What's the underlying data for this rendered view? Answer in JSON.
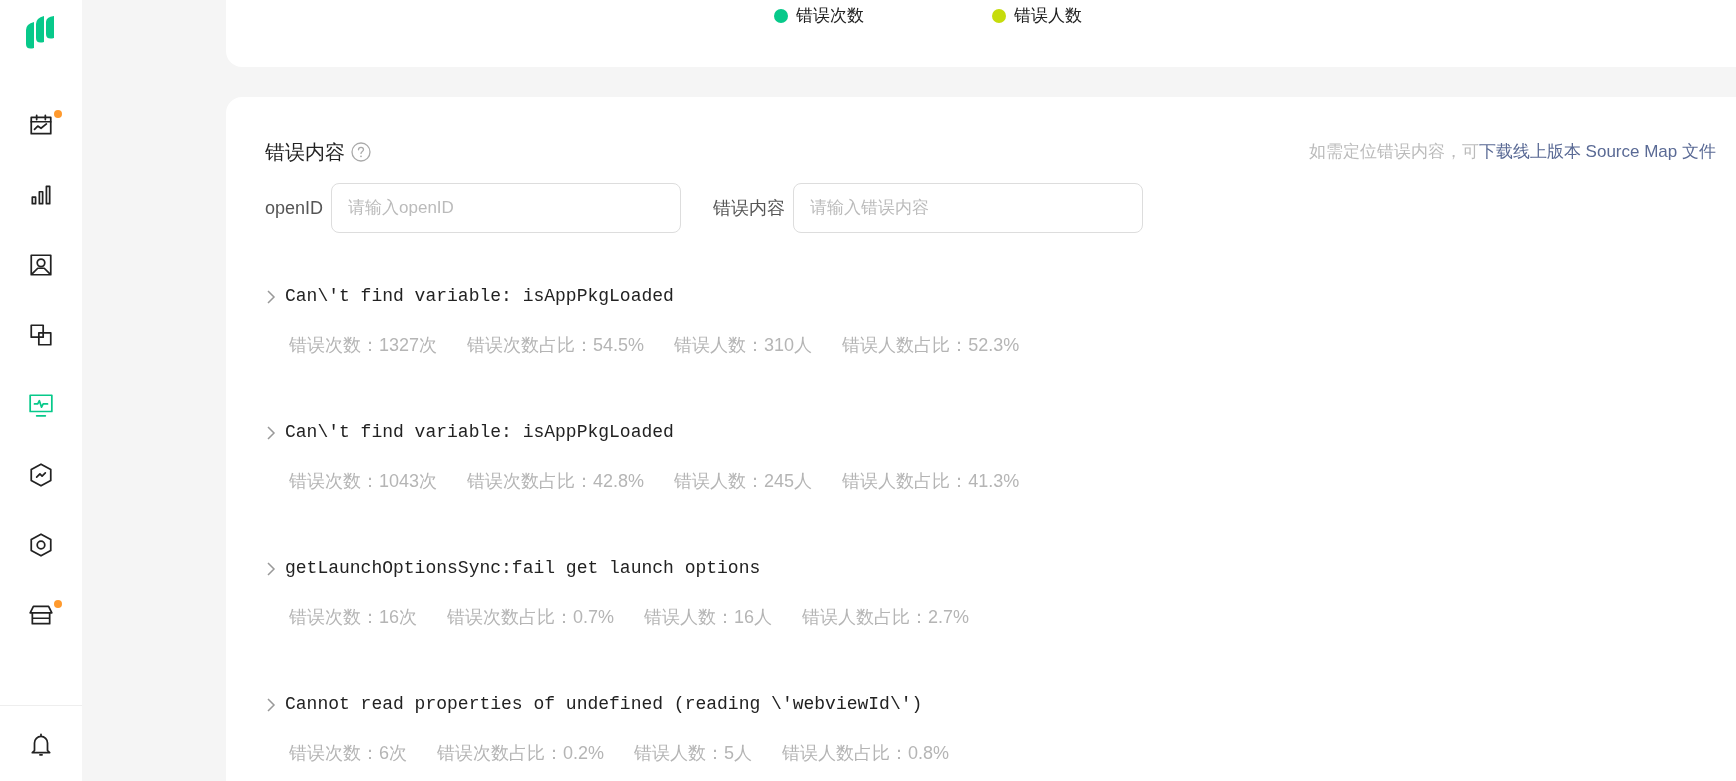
{
  "sidebar": {
    "items": [
      {
        "selected": false,
        "badge": true
      },
      {
        "selected": false,
        "badge": false
      },
      {
        "selected": false,
        "badge": false
      },
      {
        "selected": false,
        "badge": false
      },
      {
        "selected": true,
        "badge": false
      },
      {
        "selected": false,
        "badge": false
      },
      {
        "selected": false,
        "badge": false
      },
      {
        "selected": false,
        "badge": true
      }
    ]
  },
  "legend": [
    {
      "label": "错误次数",
      "color": "#07c98a"
    },
    {
      "label": "错误人数",
      "color": "#c6dc0c"
    }
  ],
  "error_panel": {
    "title": "错误内容",
    "hint": "如需定位错误内容，可",
    "hint_link": "下载线上版本 Source Map 文件",
    "filters": [
      {
        "label": "openID",
        "placeholder": "请输入openID"
      },
      {
        "label": "错误内容",
        "placeholder": "请输入错误内容"
      }
    ],
    "errors": [
      {
        "message": "Can\\'t find variable: isAppPkgLoaded",
        "expanded": false,
        "stats": [
          "错误次数：1327次",
          "错误次数占比：54.5%",
          "错误人数：310人",
          "错误人数占比：52.3%"
        ]
      },
      {
        "message": "Can\\'t find variable: isAppPkgLoaded",
        "expanded": false,
        "stats": [
          "错误次数：1043次",
          "错误次数占比：42.8%",
          "错误人数：245人",
          "错误人数占比：41.3%"
        ]
      },
      {
        "message": "getLaunchOptionsSync:fail get launch options",
        "expanded": false,
        "stats": [
          "错误次数：16次",
          "错误次数占比：0.7%",
          "错误人数：16人",
          "错误人数占比：2.7%"
        ]
      },
      {
        "message": "Cannot read properties of undefined (reading \\'webviewId\\')",
        "expanded": false,
        "stats": [
          "错误次数：6次",
          "错误次数占比：0.2%",
          "错误人数：5人",
          "错误人数占比：0.8%"
        ]
      }
    ]
  }
}
